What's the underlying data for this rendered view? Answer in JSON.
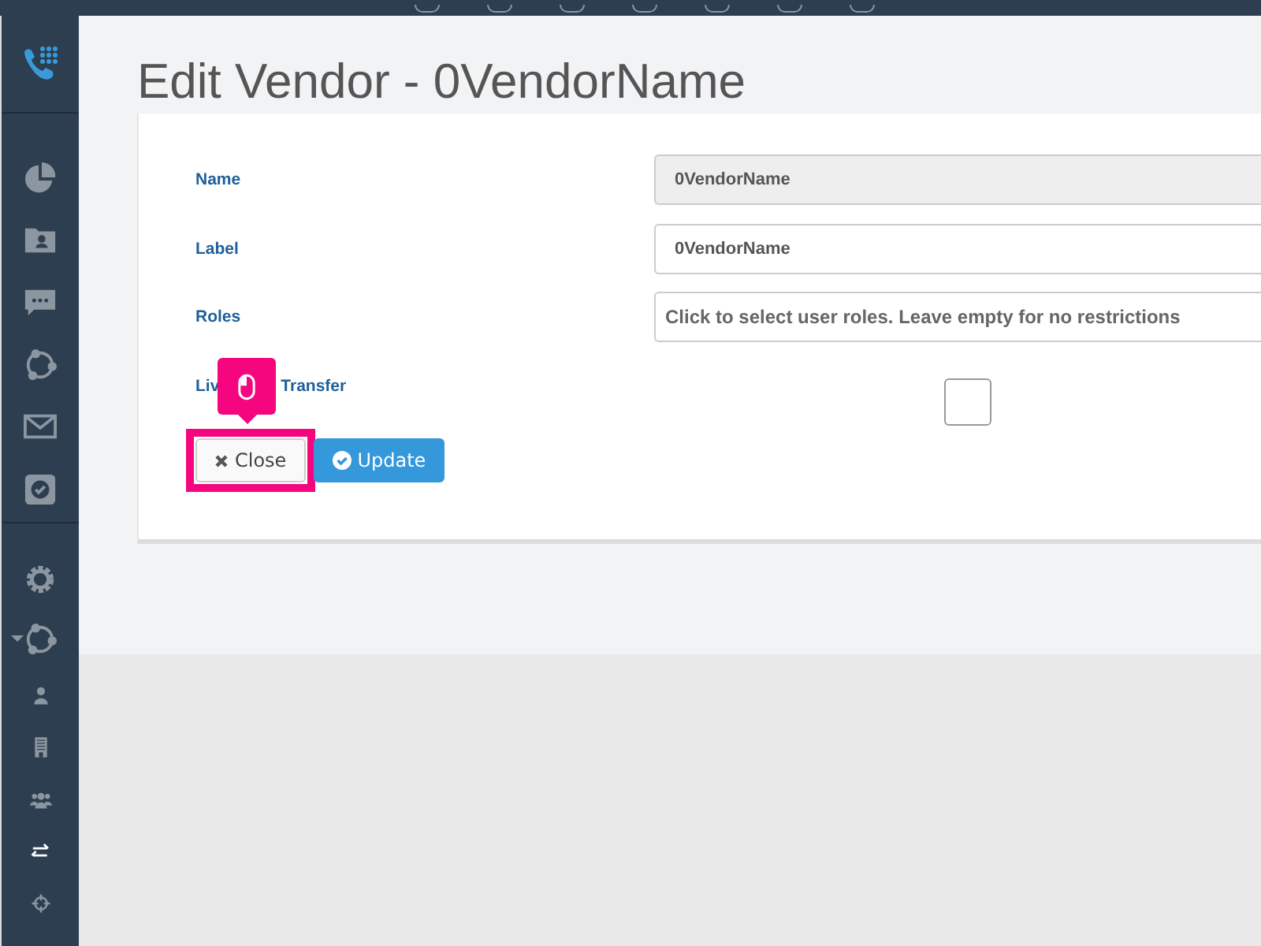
{
  "page_title": "Edit Vendor - 0VendorName",
  "sidebar": {
    "top_items": [
      {
        "kind": "pie",
        "selected": false
      },
      {
        "kind": "folder",
        "selected": false
      },
      {
        "kind": "chat",
        "selected": false
      },
      {
        "kind": "nodes",
        "selected": false
      },
      {
        "kind": "envelope",
        "selected": false
      },
      {
        "kind": "check",
        "selected": false
      }
    ],
    "bottom_items": [
      {
        "kind": "gear",
        "selected": false,
        "expanded": false
      },
      {
        "kind": "nodes",
        "selected": false,
        "expanded": true
      },
      {
        "kind": "person",
        "selected": false,
        "expanded": false
      },
      {
        "kind": "building",
        "selected": false,
        "expanded": false
      },
      {
        "kind": "users",
        "selected": false,
        "expanded": false
      },
      {
        "kind": "arrows",
        "selected": true,
        "expanded": false
      },
      {
        "kind": "crosshair",
        "selected": false,
        "expanded": false
      }
    ]
  },
  "form": {
    "fields": [
      {
        "kind": "text",
        "label": [
          "Name"
        ],
        "value": "0VendorName",
        "disabled": true
      },
      {
        "kind": "text",
        "label": [
          "Label"
        ],
        "value": "0VendorName",
        "disabled": false
      },
      {
        "kind": "select",
        "label": [
          "Roles"
        ],
        "placeholder": "Click to select user roles. Leave empty for no restrictions",
        "disabled": false
      },
      {
        "kind": "checkbox",
        "label": [
          "Liv",
          "Transfer"
        ],
        "checked": false,
        "disabled": false
      }
    ],
    "buttons": [
      {
        "kind": "close",
        "label": "Close",
        "highlighted": true
      },
      {
        "kind": "update",
        "label": "Update",
        "highlighted": false
      }
    ]
  }
}
